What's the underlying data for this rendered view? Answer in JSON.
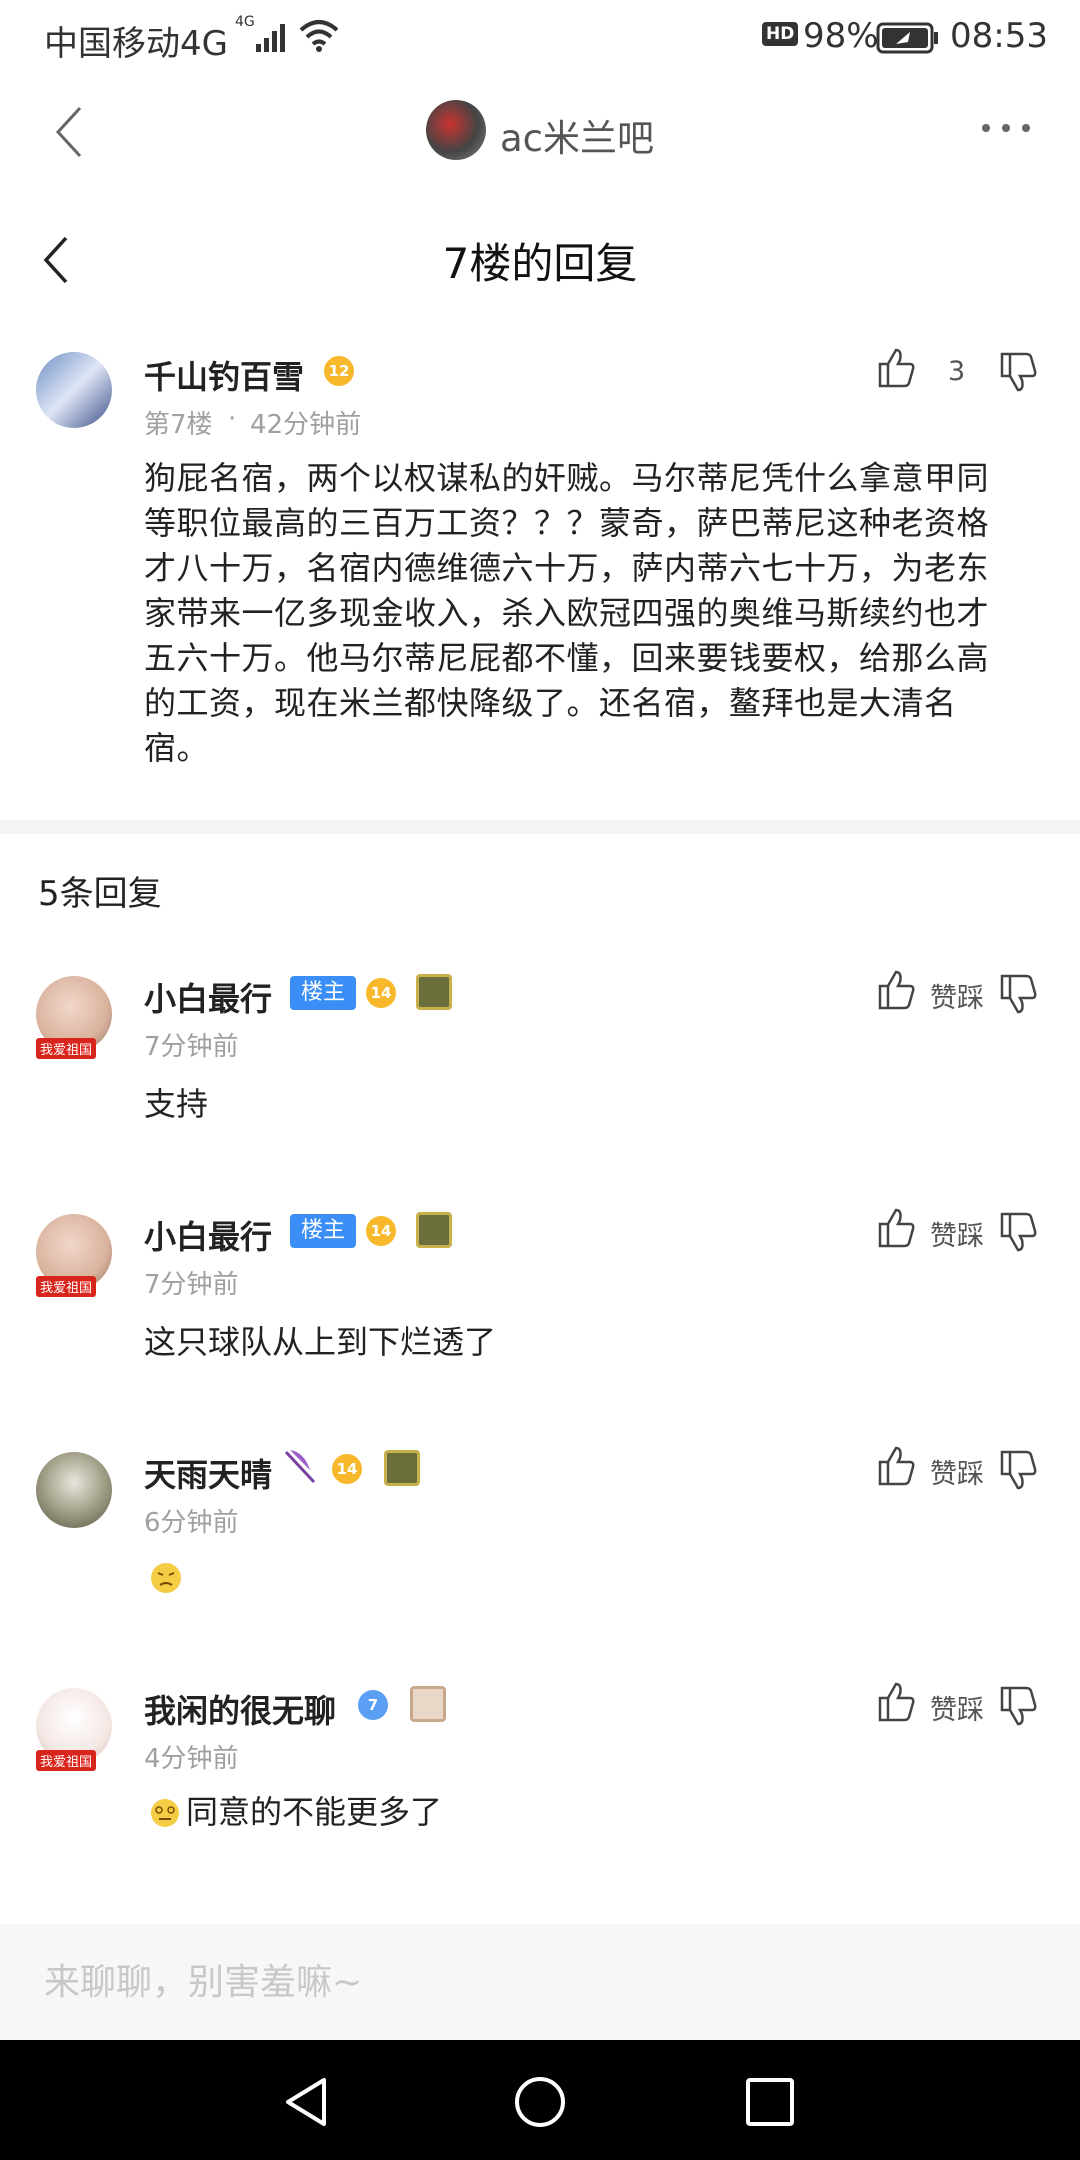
{
  "status_bar": {
    "carrier": "中国移动4G",
    "net_tag": "4G",
    "hd": "HD",
    "battery": "98%",
    "time": "08:53"
  },
  "top_nav": {
    "forum_name": "ac米兰吧"
  },
  "page": {
    "title": "7楼的回复"
  },
  "main_post": {
    "username": "千山钓百雪",
    "level": "12",
    "floor": "第7楼",
    "time": "42分钟前",
    "likes": "3",
    "content": "狗屁名宿，两个以权谋私的奸贼。马尔蒂尼凭什么拿意甲同等职位最高的三百万工资？？？蒙奇，萨巴蒂尼这种老资格才八十万，名宿内德维德六十万，萨内蒂六七十万，为老东家带来一亿多现金收入，杀入欧冠四强的奥维马斯续约也才五六十万。他马尔蒂尼屁都不懂，回来要钱要权，给那么高的工资，现在米兰都快降级了。还名宿，鳌拜也是大清名宿。"
  },
  "replies_header": "5条回复",
  "action_label": "赞踩",
  "host_badge": "楼主",
  "avatar_flag_text": "我爱祖国",
  "replies": [
    {
      "username": "小白最行",
      "level": "14",
      "time": "7分钟前",
      "content": "支持"
    },
    {
      "username": "小白最行",
      "level": "14",
      "time": "7分钟前",
      "content": "这只球队从上到下烂透了"
    },
    {
      "username": "天雨天晴",
      "level": "14",
      "time": "6分钟前",
      "content": ""
    },
    {
      "username": "我闲的很无聊",
      "level": "7",
      "time": "4分钟前",
      "content": "同意的不能更多了"
    }
  ],
  "composer": {
    "placeholder": "来聊聊，别害羞嘛~"
  }
}
